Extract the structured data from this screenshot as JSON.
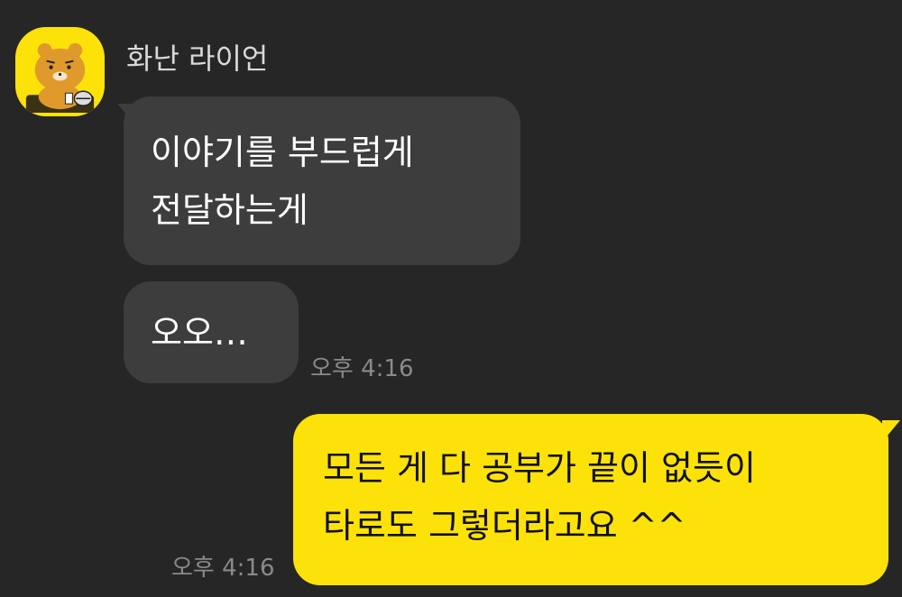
{
  "chat": {
    "sender": {
      "name": "화난 라이언",
      "avatar_icon": "ryan-character-avatar",
      "avatar_bg": "#fde20a"
    },
    "messages": [
      {
        "direction": "received",
        "text": "이야기를 부드럽게\n전달하는게",
        "time": ""
      },
      {
        "direction": "received",
        "text": "오오…",
        "time": "오후 4:16"
      },
      {
        "direction": "sent",
        "text": "모든 게 다 공부가 끝이 없듯이\n타로도 그렇더라고요 ^^",
        "time": "오후 4:16"
      }
    ]
  },
  "colors": {
    "background": "#262626",
    "received_bubble": "#3d3d3d",
    "sent_bubble": "#fde20a",
    "timestamp": "#8a8a8a"
  }
}
